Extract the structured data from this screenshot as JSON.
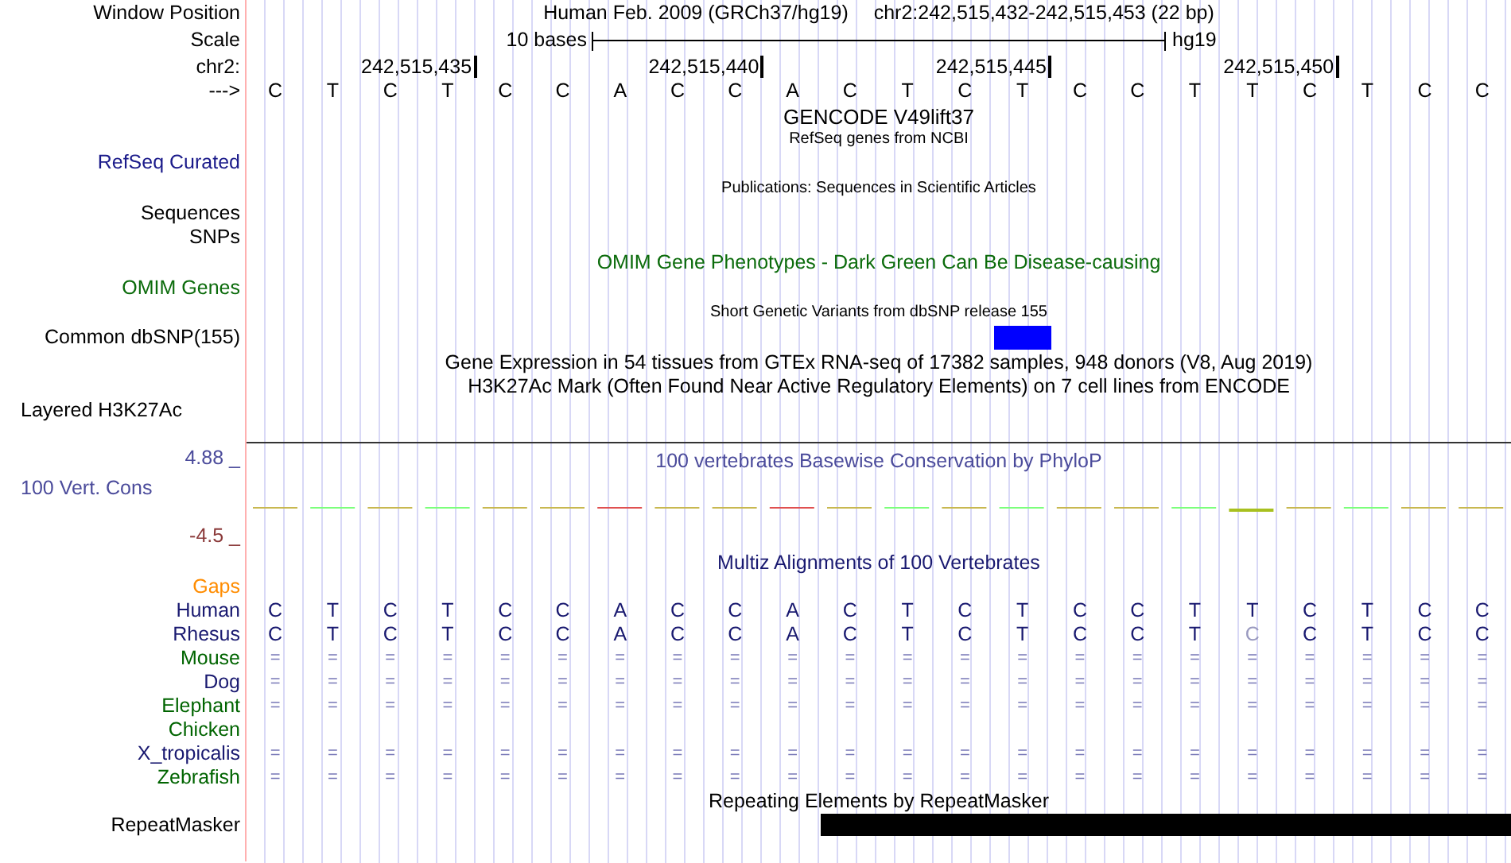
{
  "position_bar": {
    "label": "Window Position",
    "assembly": "Human Feb. 2009 (GRCh37/hg19)",
    "range": "chr2:242,515,432-242,515,453 (22 bp)"
  },
  "scale": {
    "label": "Scale",
    "length": "10 bases",
    "assembly": "hg19"
  },
  "coordinates": {
    "label": "chr2:",
    "ticks": [
      "242,515,435",
      "242,515,440",
      "242,515,445",
      "242,515,450"
    ]
  },
  "sequence": {
    "label": "--->",
    "bases": [
      "C",
      "T",
      "C",
      "T",
      "C",
      "C",
      "A",
      "C",
      "C",
      "A",
      "C",
      "T",
      "C",
      "T",
      "C",
      "C",
      "T",
      "T",
      "C",
      "T",
      "C",
      "C"
    ]
  },
  "gencode": {
    "title": "GENCODE V49lift37"
  },
  "refseq": {
    "title": "RefSeq genes from NCBI",
    "label": "RefSeq Curated"
  },
  "publications": {
    "title": "Publications: Sequences in Scientific Articles",
    "label": "Sequences"
  },
  "snps": {
    "label": "SNPs"
  },
  "omim": {
    "title": "OMIM Gene Phenotypes - Dark Green Can Be Disease-causing",
    "label": "OMIM Genes"
  },
  "dbsnp": {
    "title": "Short Genetic Variants from dbSNP release 155",
    "label": "Common dbSNP(155)"
  },
  "gtex": {
    "title": "Gene Expression in 54 tissues from GTEx RNA-seq of 17382 samples, 948 donors (V8, Aug 2019)"
  },
  "h3k27ac": {
    "title": "H3K27Ac Mark (Often Found Near Active Regulatory Elements) on 7 cell lines from ENCODE",
    "label": "Layered H3K27Ac"
  },
  "conservation": {
    "title": "100 vertebrates Basewise Conservation by PhyloP",
    "label": "100 Vert. Cons",
    "max": "4.88 _",
    "min": "-4.5 _"
  },
  "multiz": {
    "title": "Multiz Alignments of 100 Vertebrates",
    "gaps_label": "Gaps",
    "species": [
      {
        "name": "Human",
        "color": "#191970",
        "kind": "bases",
        "bases": [
          {
            "b": "C",
            "mismatch": false
          },
          {
            "b": "T",
            "mismatch": false
          },
          {
            "b": "C",
            "mismatch": false
          },
          {
            "b": "T",
            "mismatch": false
          },
          {
            "b": "C",
            "mismatch": false
          },
          {
            "b": "C",
            "mismatch": false
          },
          {
            "b": "A",
            "mismatch": false
          },
          {
            "b": "C",
            "mismatch": false
          },
          {
            "b": "C",
            "mismatch": false
          },
          {
            "b": "A",
            "mismatch": false
          },
          {
            "b": "C",
            "mismatch": false
          },
          {
            "b": "T",
            "mismatch": false
          },
          {
            "b": "C",
            "mismatch": false
          },
          {
            "b": "T",
            "mismatch": false
          },
          {
            "b": "C",
            "mismatch": false
          },
          {
            "b": "C",
            "mismatch": false
          },
          {
            "b": "T",
            "mismatch": false
          },
          {
            "b": "T",
            "mismatch": false
          },
          {
            "b": "C",
            "mismatch": false
          },
          {
            "b": "T",
            "mismatch": false
          },
          {
            "b": "C",
            "mismatch": false
          },
          {
            "b": "C",
            "mismatch": false
          }
        ]
      },
      {
        "name": "Rhesus",
        "color": "#191970",
        "kind": "bases",
        "bases": [
          {
            "b": "C",
            "mismatch": false
          },
          {
            "b": "T",
            "mismatch": false
          },
          {
            "b": "C",
            "mismatch": false
          },
          {
            "b": "T",
            "mismatch": false
          },
          {
            "b": "C",
            "mismatch": false
          },
          {
            "b": "C",
            "mismatch": false
          },
          {
            "b": "A",
            "mismatch": false
          },
          {
            "b": "C",
            "mismatch": false
          },
          {
            "b": "C",
            "mismatch": false
          },
          {
            "b": "A",
            "mismatch": false
          },
          {
            "b": "C",
            "mismatch": false
          },
          {
            "b": "T",
            "mismatch": false
          },
          {
            "b": "C",
            "mismatch": false
          },
          {
            "b": "T",
            "mismatch": false
          },
          {
            "b": "C",
            "mismatch": false
          },
          {
            "b": "C",
            "mismatch": false
          },
          {
            "b": "T",
            "mismatch": false
          },
          {
            "b": "C",
            "mismatch": true
          },
          {
            "b": "C",
            "mismatch": false
          },
          {
            "b": "T",
            "mismatch": false
          },
          {
            "b": "C",
            "mismatch": false
          },
          {
            "b": "C",
            "mismatch": false
          }
        ]
      },
      {
        "name": "Mouse",
        "color": "#006400",
        "kind": "equals",
        "bases": [
          "=",
          "=",
          "=",
          "=",
          "=",
          "=",
          "=",
          "=",
          "=",
          "=",
          "=",
          "=",
          "=",
          "=",
          "=",
          "=",
          "=",
          "=",
          "=",
          "=",
          "=",
          "="
        ]
      },
      {
        "name": "Dog",
        "color": "#191970",
        "kind": "equals",
        "bases": [
          "=",
          "=",
          "=",
          "=",
          "=",
          "=",
          "=",
          "=",
          "=",
          "=",
          "=",
          "=",
          "=",
          "=",
          "=",
          "=",
          "=",
          "=",
          "=",
          "=",
          "=",
          "="
        ]
      },
      {
        "name": "Elephant",
        "color": "#006400",
        "kind": "equals",
        "bases": [
          "=",
          "=",
          "=",
          "=",
          "=",
          "=",
          "=",
          "=",
          "=",
          "=",
          "=",
          "=",
          "=",
          "=",
          "=",
          "=",
          "=",
          "=",
          "=",
          "=",
          "=",
          "="
        ]
      },
      {
        "name": "Chicken",
        "color": "#006400",
        "kind": "empty"
      },
      {
        "name": "X_tropicalis",
        "color": "#191970",
        "kind": "equals",
        "bases": [
          "=",
          "=",
          "=",
          "=",
          "=",
          "=",
          "=",
          "=",
          "=",
          "=",
          "=",
          "=",
          "=",
          "=",
          "=",
          "=",
          "=",
          "=",
          "=",
          "=",
          "=",
          "="
        ]
      },
      {
        "name": "Zebrafish",
        "color": "#006400",
        "kind": "equals",
        "bases": [
          "=",
          "=",
          "=",
          "=",
          "=",
          "=",
          "=",
          "=",
          "=",
          "=",
          "=",
          "=",
          "=",
          "=",
          "=",
          "=",
          "=",
          "=",
          "=",
          "=",
          "=",
          "="
        ]
      }
    ]
  },
  "repeatmasker": {
    "title": "Repeating Elements by RepeatMasker",
    "label": "RepeatMasker"
  }
}
